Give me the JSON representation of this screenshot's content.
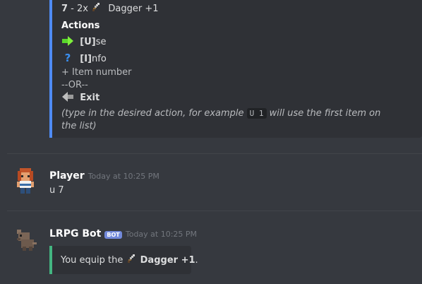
{
  "embed1": {
    "item_line": {
      "number": "7",
      "rest": " - 2x ",
      "item": "Dagger +1"
    },
    "actions_heading": "Actions",
    "use": {
      "key": "[U]",
      "rest": "se"
    },
    "info": {
      "key": "[I]",
      "rest": "nfo"
    },
    "item_number": "+ Item number",
    "or": "--OR--",
    "exit": "Exit",
    "hint_prefix": "(type in the desired action, for example ",
    "hint_code": "U 1",
    "hint_suffix": " will use the first item on",
    "hint_line2": "the list)",
    "accent_color": "#4f8bf4"
  },
  "messages": [
    {
      "author": "Player",
      "timestamp": "Today at 10:25 PM",
      "text": "u 7"
    },
    {
      "author": "LRPG Bot",
      "badge": "BOT",
      "timestamp": "Today at 10:25 PM",
      "embed": {
        "prefix": "You equip the ",
        "item": "Dagger +1",
        "suffix": ".",
        "accent_color": "#43b581"
      }
    }
  ],
  "icons": {
    "dagger": "dagger-icon",
    "use": "green-arrow-right-icon",
    "info": "question-mark-icon",
    "exit": "grey-arrow-left-icon"
  }
}
